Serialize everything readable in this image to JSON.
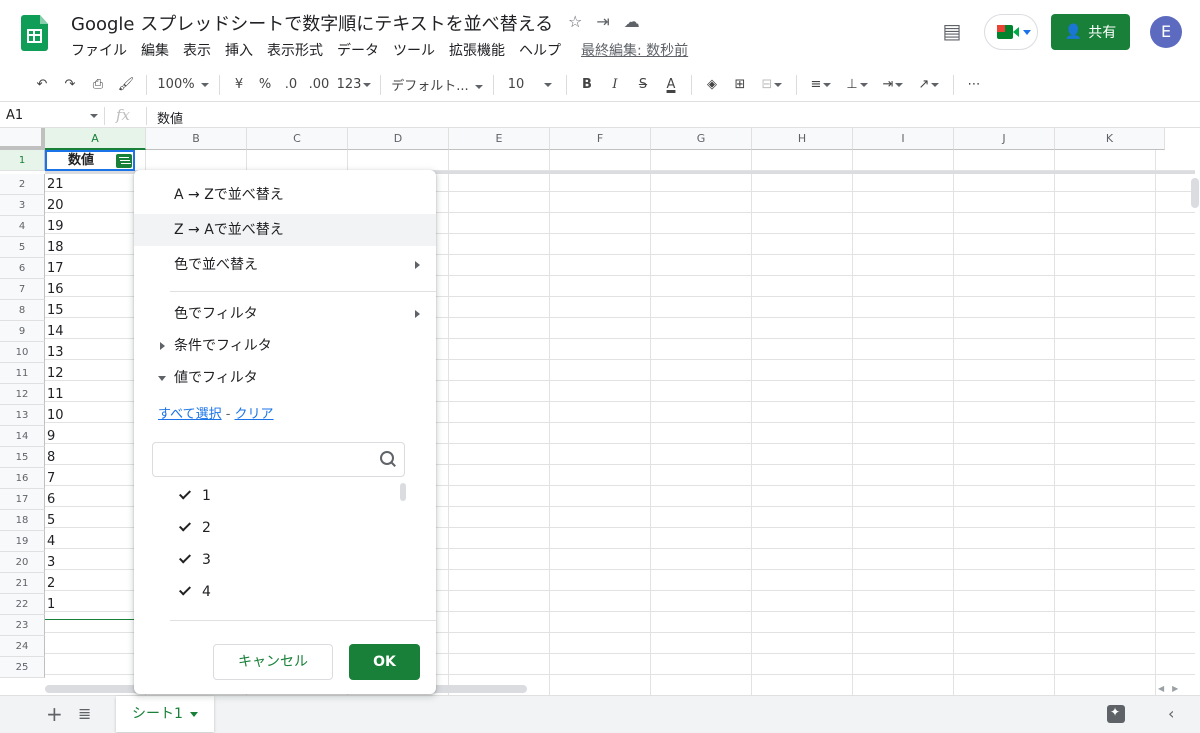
{
  "header": {
    "doc_title": "Google スプレッドシートで数字順にテキストを並べ替える",
    "menu": [
      "ファイル",
      "編集",
      "表示",
      "挿入",
      "表示形式",
      "データ",
      "ツール",
      "拡張機能",
      "ヘルプ"
    ],
    "last_edit": "最終編集: 数秒前",
    "share_label": "共有",
    "avatar_initial": "E",
    "icons": [
      "star-icon",
      "move-folder-icon",
      "cloud-status-icon",
      "comment-icon",
      "meet-icon"
    ]
  },
  "toolbar": {
    "zoom": "100%",
    "currency": "¥",
    "percent": "%",
    "decimal_decrease": ".0",
    "decimal_increase": ".00",
    "number_format": "123",
    "font": "デフォルト...",
    "font_size": "10",
    "bold": "B",
    "italic": "I",
    "strike": "S",
    "text_color": "A",
    "more": "⋯"
  },
  "formula_bar": {
    "cell_ref": "A1",
    "fx": "fx",
    "value": "数値"
  },
  "grid": {
    "columns": [
      "A",
      "B",
      "C",
      "D",
      "E",
      "F",
      "G",
      "H",
      "I",
      "J",
      "K"
    ],
    "rows": [
      "1",
      "2",
      "3",
      "4",
      "5",
      "6",
      "7",
      "8",
      "9",
      "10",
      "11",
      "12",
      "13",
      "14",
      "15",
      "16",
      "17",
      "18",
      "19",
      "20",
      "21",
      "22",
      "23",
      "24",
      "25"
    ],
    "colA": [
      "数値",
      "21",
      "20",
      "19",
      "18",
      "17",
      "16",
      "15",
      "14",
      "13",
      "12",
      "11",
      "10",
      "9",
      "8",
      "7",
      "6",
      "5",
      "4",
      "3",
      "2",
      "1"
    ]
  },
  "filter_menu": {
    "sort_az": "A → Zで並べ替え",
    "sort_za": "Z → Aで並べ替え",
    "sort_color": "色で並べ替え",
    "filter_color": "色でフィルタ",
    "filter_condition": "条件でフィルタ",
    "filter_value": "値でフィルタ",
    "select_all": "すべて選択",
    "separator": " - ",
    "clear": "クリア",
    "values": [
      "1",
      "2",
      "3",
      "4"
    ],
    "cancel": "キャンセル",
    "ok": "OK"
  },
  "bottom": {
    "sheet_name": "シート1"
  },
  "colors": {
    "accent_green": "#188038",
    "selection_blue": "#1a73e8"
  }
}
